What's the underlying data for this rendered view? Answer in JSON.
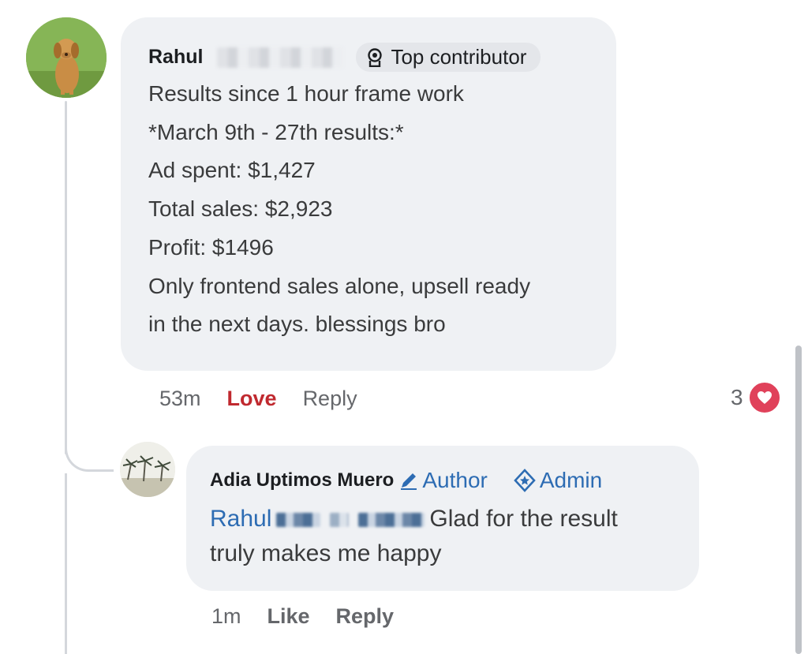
{
  "comment": {
    "author": "Rahul",
    "badge": "Top contributor",
    "badge_icon": "contributor-badge-icon",
    "lines": [
      "Results since 1 hour frame work",
      "*March 9th - 27th results:*",
      "Ad spent: $1,427",
      "Total sales: $2,923",
      "Profit: $1496",
      "Only frontend sales alone, upsell ready",
      "in the next days. blessings bro"
    ],
    "time": "53m",
    "love_label": "Love",
    "reply_label": "Reply",
    "reaction_count": "3",
    "reaction_icon": "heart-reaction-icon",
    "love_color": "#c0292f"
  },
  "reply": {
    "author": "Adia Uptimos Muero",
    "author_role": "Author",
    "admin_role": "Admin",
    "mention": "Rahul",
    "text_line1": "Glad for the result",
    "text_line2": "truly makes me happy",
    "time": "1m",
    "like_label": "Like",
    "reply_label": "Reply",
    "accent_color": "#2d6cb3"
  }
}
